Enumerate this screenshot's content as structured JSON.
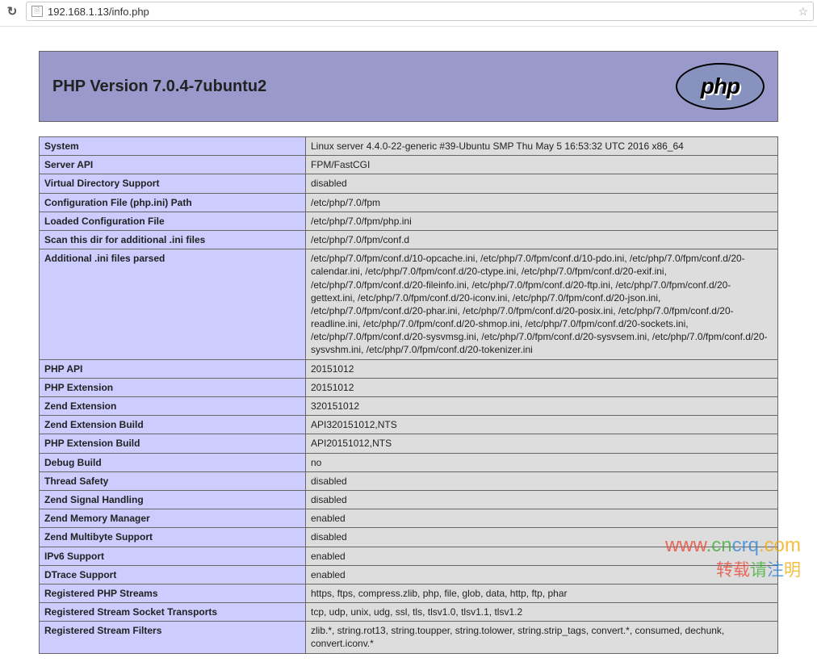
{
  "browser": {
    "url": "192.168.1.13/info.php"
  },
  "header": {
    "title": "PHP Version 7.0.4-7ubuntu2",
    "logo_text": "php"
  },
  "rows": [
    {
      "k": "System",
      "v": "Linux server 4.4.0-22-generic #39-Ubuntu SMP Thu May 5 16:53:32 UTC 2016 x86_64"
    },
    {
      "k": "Server API",
      "v": "FPM/FastCGI"
    },
    {
      "k": "Virtual Directory Support",
      "v": "disabled"
    },
    {
      "k": "Configuration File (php.ini) Path",
      "v": "/etc/php/7.0/fpm"
    },
    {
      "k": "Loaded Configuration File",
      "v": "/etc/php/7.0/fpm/php.ini"
    },
    {
      "k": "Scan this dir for additional .ini files",
      "v": "/etc/php/7.0/fpm/conf.d"
    },
    {
      "k": "Additional .ini files parsed",
      "v": "/etc/php/7.0/fpm/conf.d/10-opcache.ini, /etc/php/7.0/fpm/conf.d/10-pdo.ini, /etc/php/7.0/fpm/conf.d/20-calendar.ini, /etc/php/7.0/fpm/conf.d/20-ctype.ini, /etc/php/7.0/fpm/conf.d/20-exif.ini, /etc/php/7.0/fpm/conf.d/20-fileinfo.ini, /etc/php/7.0/fpm/conf.d/20-ftp.ini, /etc/php/7.0/fpm/conf.d/20-gettext.ini, /etc/php/7.0/fpm/conf.d/20-iconv.ini, /etc/php/7.0/fpm/conf.d/20-json.ini, /etc/php/7.0/fpm/conf.d/20-phar.ini, /etc/php/7.0/fpm/conf.d/20-posix.ini, /etc/php/7.0/fpm/conf.d/20-readline.ini, /etc/php/7.0/fpm/conf.d/20-shmop.ini, /etc/php/7.0/fpm/conf.d/20-sockets.ini, /etc/php/7.0/fpm/conf.d/20-sysvmsg.ini, /etc/php/7.0/fpm/conf.d/20-sysvsem.ini, /etc/php/7.0/fpm/conf.d/20-sysvshm.ini, /etc/php/7.0/fpm/conf.d/20-tokenizer.ini"
    },
    {
      "k": "PHP API",
      "v": "20151012"
    },
    {
      "k": "PHP Extension",
      "v": "20151012"
    },
    {
      "k": "Zend Extension",
      "v": "320151012"
    },
    {
      "k": "Zend Extension Build",
      "v": "API320151012,NTS"
    },
    {
      "k": "PHP Extension Build",
      "v": "API20151012,NTS"
    },
    {
      "k": "Debug Build",
      "v": "no"
    },
    {
      "k": "Thread Safety",
      "v": "disabled"
    },
    {
      "k": "Zend Signal Handling",
      "v": "disabled"
    },
    {
      "k": "Zend Memory Manager",
      "v": "enabled"
    },
    {
      "k": "Zend Multibyte Support",
      "v": "disabled"
    },
    {
      "k": "IPv6 Support",
      "v": "enabled"
    },
    {
      "k": "DTrace Support",
      "v": "enabled"
    },
    {
      "k": "Registered PHP Streams",
      "v": "https, ftps, compress.zlib, php, file, glob, data, http, ftp, phar"
    },
    {
      "k": "Registered Stream Socket Transports",
      "v": "tcp, udp, unix, udg, ssl, tls, tlsv1.0, tlsv1.1, tlsv1.2"
    },
    {
      "k": "Registered Stream Filters",
      "v": "zlib.*, string.rot13, string.toupper, string.tolower, string.strip_tags, convert.*, consumed, dechunk, convert.iconv.*"
    }
  ],
  "watermark": {
    "l1a": "www",
    "l1b": ".cn",
    "l1c": "crq",
    "l1d": ".com",
    "l2a": "转载",
    "l2b": "请",
    "l2c": "注",
    "l2d": "明"
  }
}
